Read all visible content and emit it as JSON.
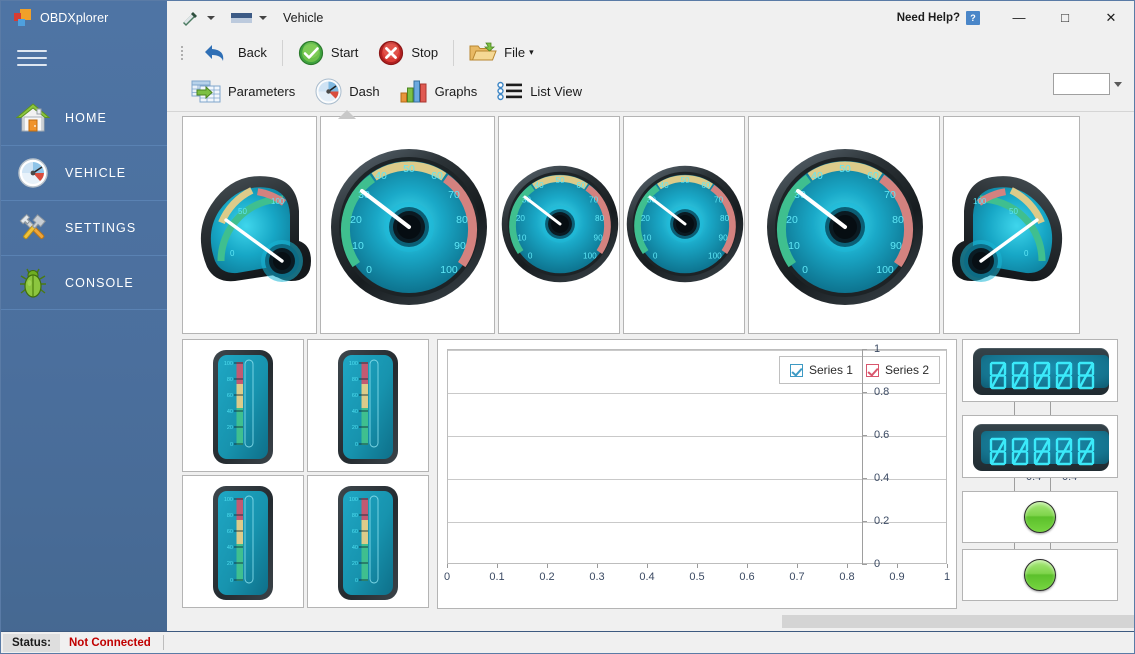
{
  "app": {
    "brand": "OBDXplorer",
    "window_title": "Vehicle"
  },
  "sidebar": {
    "menu_icon": "hamburger-icon",
    "items": [
      {
        "label": "HOME",
        "icon": "house-icon"
      },
      {
        "label": "VEHICLE",
        "icon": "gauge-icon"
      },
      {
        "label": "SETTINGS",
        "icon": "wrench-hammer-icon"
      },
      {
        "label": "CONSOLE",
        "icon": "bug-icon"
      }
    ]
  },
  "titlebar": {
    "need_help": "Need Help?",
    "help_button": "?",
    "minimize": "—",
    "maximize": "□",
    "close": "✕"
  },
  "ribbon": {
    "row1": [
      {
        "label": "Back",
        "icon": "back-arrow-icon"
      },
      {
        "label": "Start",
        "icon": "green-check-icon"
      },
      {
        "label": "Stop",
        "icon": "red-x-icon"
      },
      {
        "label": "File",
        "icon": "folder-icon",
        "caret": "▾"
      }
    ],
    "row2": [
      {
        "label": "Parameters",
        "icon": "table-export-icon",
        "active": false
      },
      {
        "label": "Dash",
        "icon": "dash-gauge-icon",
        "active": true
      },
      {
        "label": "Graphs",
        "icon": "bar-chart-icon",
        "active": false
      },
      {
        "label": "List View",
        "icon": "list-view-icon",
        "active": false
      }
    ],
    "combo_value": ""
  },
  "gauges": {
    "scale_min": 0,
    "scale_max": 100,
    "round_labels": [
      "0",
      "10",
      "20",
      "30",
      "40",
      "50",
      "60",
      "70",
      "80",
      "90",
      "100"
    ],
    "quarter_labels": [
      "0",
      "50",
      "100"
    ],
    "vertical_labels": [
      "0",
      "20",
      "40",
      "60",
      "80",
      "100"
    ],
    "value": 35,
    "band_colors": {
      "green": "#3fbf8f",
      "amber": "#dccb8a",
      "red": "#d4827f"
    },
    "dial_color": "#19a8c8",
    "needle_color": "#ffffff"
  },
  "chart_data": {
    "type": "line",
    "title": "",
    "xlabel": "",
    "ylabel": "",
    "xlim": [
      0,
      1
    ],
    "ylim": [
      0,
      1
    ],
    "x_ticks": [
      "0",
      "0.1",
      "0.2",
      "0.3",
      "0.4",
      "0.5",
      "0.6",
      "0.7",
      "0.8",
      "0.9",
      "1"
    ],
    "y_ticks": [
      "0",
      "0.2",
      "0.4",
      "0.6",
      "0.8",
      "1"
    ],
    "y_axis_count": 3,
    "grid": true,
    "legend_position": "top-right",
    "series": [
      {
        "name": "Series 1",
        "color": "#3d9ac4",
        "checked": true,
        "values": []
      },
      {
        "name": "Series 2",
        "color": "#d9566d",
        "checked": true,
        "values": []
      }
    ]
  },
  "lcd": {
    "digits": "00000",
    "displays": [
      "00000",
      "00000"
    ],
    "indicators": [
      "on",
      "on"
    ]
  },
  "statusbar": {
    "label": "Status:",
    "value": "Not Connected"
  }
}
